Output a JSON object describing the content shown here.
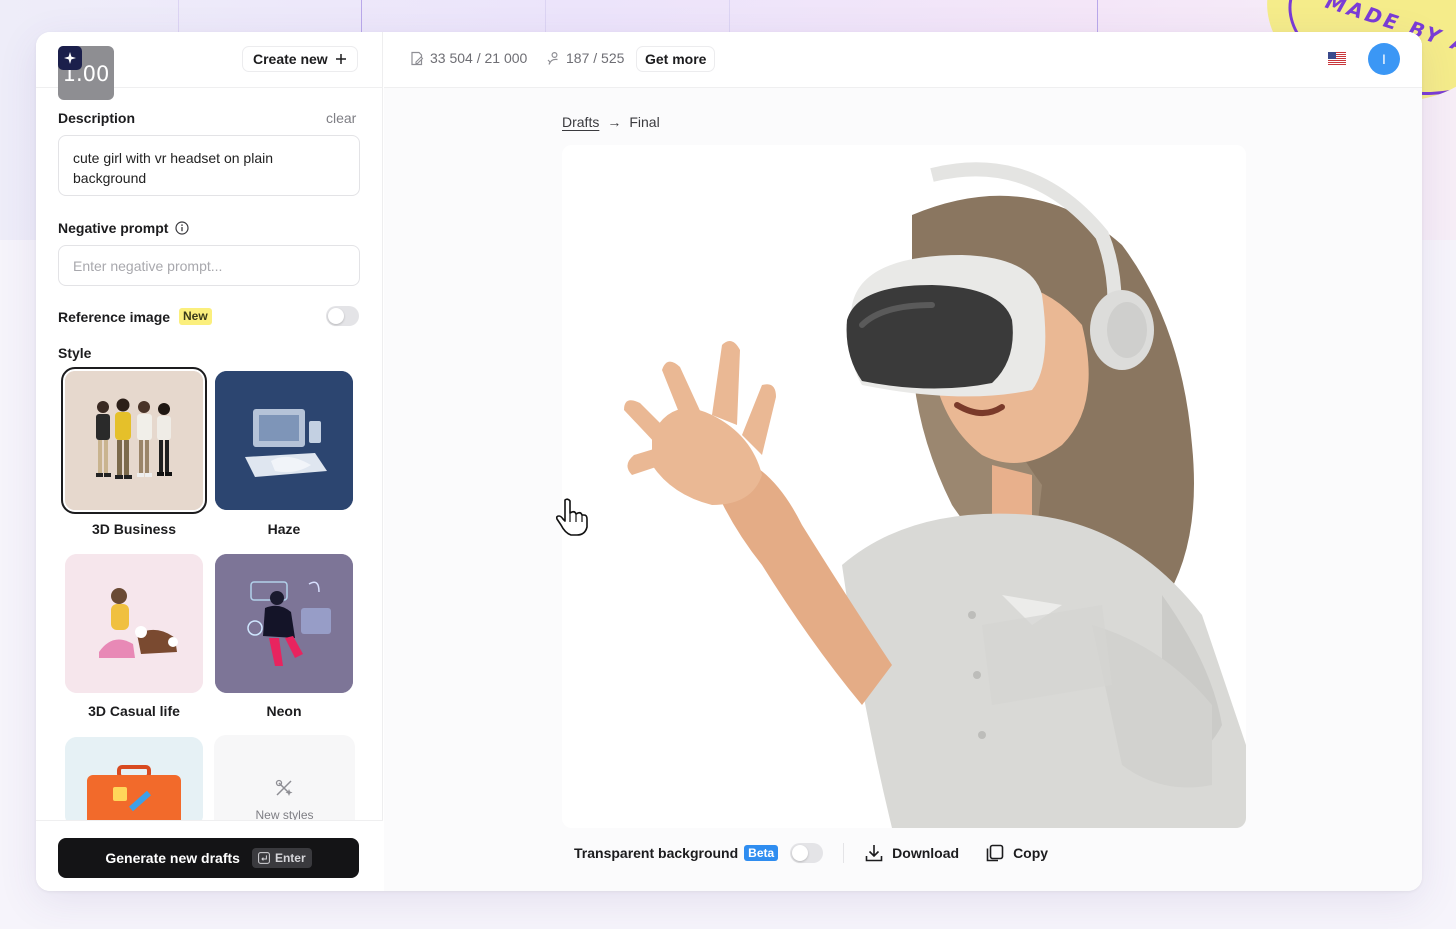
{
  "sticker": {
    "text": "MADE BY A"
  },
  "sidebar": {
    "logo_text": "1.00",
    "create_new_label": "Create new",
    "description": {
      "label": "Description",
      "clear_label": "clear",
      "value": "cute girl with vr headset on plain background"
    },
    "negative_prompt": {
      "label": "Negative prompt",
      "placeholder": "Enter negative prompt..."
    },
    "reference_image": {
      "label": "Reference image",
      "badge": "New",
      "enabled": false
    },
    "style": {
      "label": "Style",
      "items": [
        {
          "name": "3D Business",
          "selected": true
        },
        {
          "name": "Haze",
          "selected": false
        },
        {
          "name": "3D Casual life",
          "selected": false
        },
        {
          "name": "Neon",
          "selected": false
        }
      ],
      "new_styles_label": "New styles"
    },
    "generate": {
      "label": "Generate new drafts",
      "shortcut": "Enter"
    }
  },
  "topbar": {
    "credits": "33 504 / 21 000",
    "generations": "187 / 525",
    "get_more_label": "Get more",
    "avatar_initial": "I"
  },
  "breadcrumb": {
    "drafts": "Drafts",
    "arrow": "→",
    "final": "Final"
  },
  "actions": {
    "transparent_label": "Transparent background",
    "transparent_badge": "Beta",
    "transparent_enabled": false,
    "download_label": "Download",
    "copy_label": "Copy"
  },
  "colors": {
    "accent_blue": "#2f8df0",
    "avatar_blue": "#3b97f5",
    "new_badge_yellow": "#fbef7d",
    "sticker_purple": "#7a3cd6",
    "primary_button": "#141416"
  }
}
